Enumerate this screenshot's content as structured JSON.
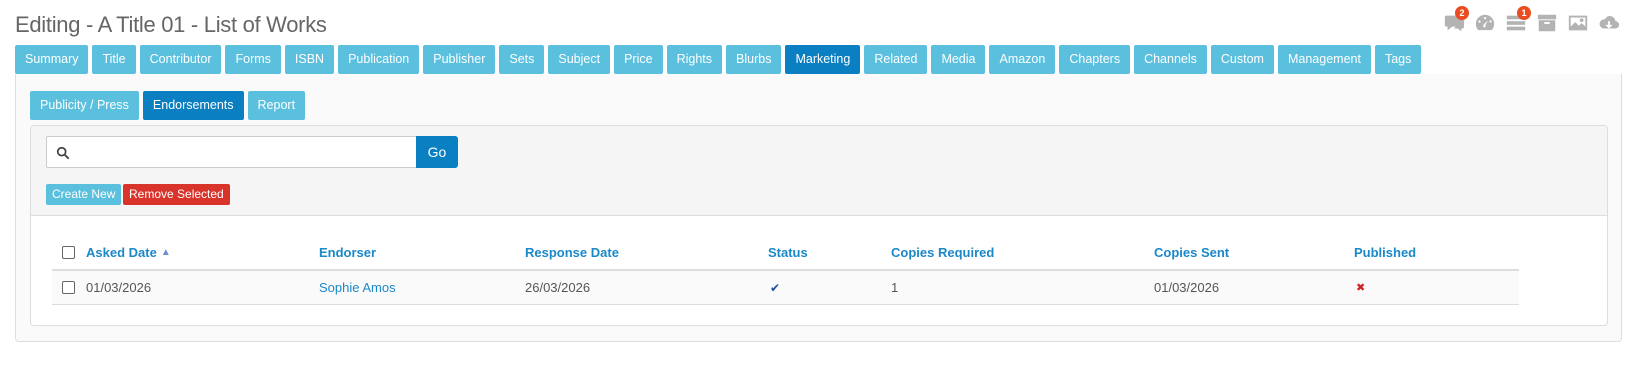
{
  "header": {
    "title": "Editing - A Title 01 - List of Works"
  },
  "top_icons": [
    {
      "name": "comments-icon",
      "badge": "2"
    },
    {
      "name": "dashboard-icon",
      "badge": ""
    },
    {
      "name": "tasks-icon",
      "badge": "1"
    },
    {
      "name": "archive-icon",
      "badge": ""
    },
    {
      "name": "image-icon",
      "badge": ""
    },
    {
      "name": "cloud-download-icon",
      "badge": ""
    }
  ],
  "tabs": [
    {
      "label": "Summary",
      "active": false
    },
    {
      "label": "Title",
      "active": false
    },
    {
      "label": "Contributor",
      "active": false
    },
    {
      "label": "Forms",
      "active": false
    },
    {
      "label": "ISBN",
      "active": false
    },
    {
      "label": "Publication",
      "active": false
    },
    {
      "label": "Publisher",
      "active": false
    },
    {
      "label": "Sets",
      "active": false
    },
    {
      "label": "Subject",
      "active": false
    },
    {
      "label": "Price",
      "active": false
    },
    {
      "label": "Rights",
      "active": false
    },
    {
      "label": "Blurbs",
      "active": false
    },
    {
      "label": "Marketing",
      "active": true
    },
    {
      "label": "Related",
      "active": false
    },
    {
      "label": "Media",
      "active": false
    },
    {
      "label": "Amazon",
      "active": false
    },
    {
      "label": "Chapters",
      "active": false
    },
    {
      "label": "Channels",
      "active": false
    },
    {
      "label": "Custom",
      "active": false
    },
    {
      "label": "Management",
      "active": false
    },
    {
      "label": "Tags",
      "active": false
    }
  ],
  "subtabs": [
    {
      "label": "Publicity / Press",
      "active": false
    },
    {
      "label": "Endorsements",
      "active": true
    },
    {
      "label": "Report",
      "active": false
    }
  ],
  "search": {
    "value": "",
    "placeholder": "",
    "go_label": "Go"
  },
  "actions": {
    "create_label": "Create New",
    "remove_label": "Remove Selected"
  },
  "table": {
    "columns": {
      "asked_date": "Asked Date",
      "endorser": "Endorser",
      "response_date": "Response Date",
      "status": "Status",
      "copies_required": "Copies Required",
      "copies_sent": "Copies Sent",
      "published": "Published"
    },
    "sort_indicator": "▲",
    "rows": [
      {
        "asked_date": "01/03/2026",
        "endorser": "Sophie Amos",
        "response_date": "26/03/2026",
        "status": "✔",
        "copies_required": "1",
        "copies_sent": "01/03/2026",
        "published": "✖"
      }
    ]
  },
  "colors": {
    "tab": "#5bc0de",
    "tab_active": "#0a7fc2",
    "danger": "#d9342b",
    "link": "#1a88c9",
    "badge": "#e84c1f",
    "status_check": "#1a4fa0",
    "published_x": "#cc2222"
  }
}
